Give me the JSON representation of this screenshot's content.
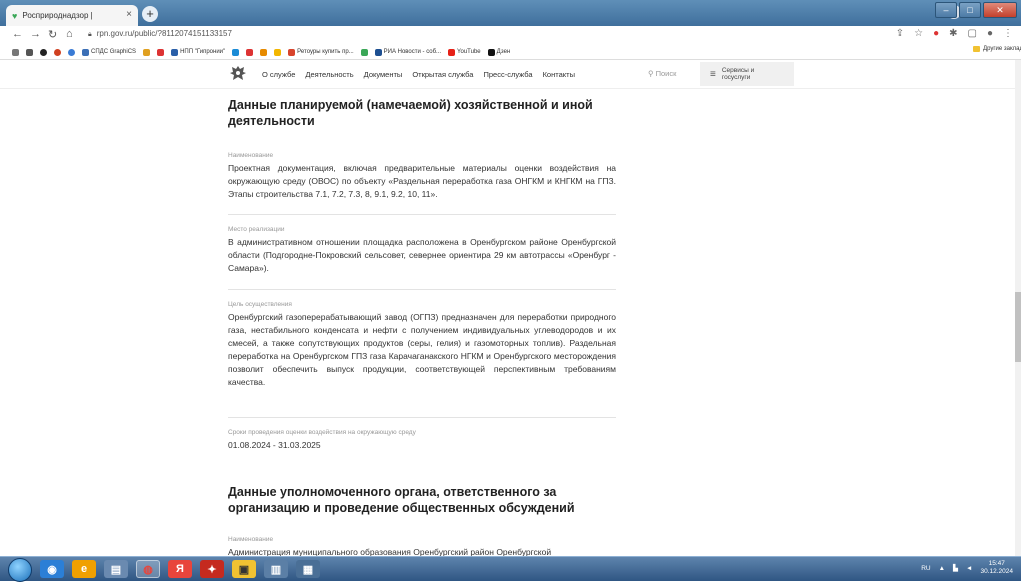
{
  "browser": {
    "tab_title": "Росприроднадзор |",
    "tab_close": "×",
    "new_tab": "+",
    "url": "rpn.gov.ru/public/?8112074151133157",
    "window_buttons": [
      "–",
      "□",
      "✕"
    ]
  },
  "bookmarks": [
    {
      "label": "СПДС GraphiCS",
      "color": "#3b6fb6"
    },
    {
      "label": "",
      "color": "#e0a020"
    },
    {
      "label": "",
      "color": "#d33"
    },
    {
      "label": "НПП \"Гипронии\"",
      "color": "#2a5fa8"
    },
    {
      "label": "",
      "color": "#1a8bd6"
    },
    {
      "label": "",
      "color": "#d33"
    },
    {
      "label": "",
      "color": "#e68a00"
    },
    {
      "label": "",
      "color": "#f2b600"
    },
    {
      "label": "Ретоуры купить пр...",
      "color": "#d8442c"
    },
    {
      "label": "",
      "color": "#3aa757"
    },
    {
      "label": "РИА Новости - соб...",
      "color": "#1d4f91"
    },
    {
      "label": "YouTube",
      "color": "#e62117"
    },
    {
      "label": "Дзен",
      "color": "#111"
    }
  ],
  "bookmarks_right": "Другие закладки",
  "site": {
    "nav": [
      "О службе",
      "Деятельность",
      "Документы",
      "Открытая служба",
      "Пресс-служба",
      "Контакты"
    ],
    "search": "Поиск",
    "services_line1": "Сервисы и",
    "services_line2": "госуслуги"
  },
  "main": {
    "section1_title": "Данные планируемой (намечаемой) хозяйственной и иной деятельности",
    "name_label": "Наименование",
    "name_value": "Проектная документация, включая предварительные материалы оценки воздействия на окружающую среду (ОВОС) по объекту «Раздельная переработка газа ОНГКМ и КНГКМ на ГПЗ. Этапы строительства 7.1, 7.2, 7.3, 8, 9.1, 9.2, 10, 11».",
    "place_label": "Место реализации",
    "place_value": "В административном отношении площадка расположена в Оренбургском районе Оренбургской области (Подгородне-Покровский сельсовет, севернее ориентира 29 км автотрассы «Оренбург - Самара»).",
    "goal_label": "Цель осуществления",
    "goal_value": "Оренбургский газоперерабатывающий завод (ОГПЗ) предназначен для переработки природного газа, нестабильного конденсата и нефти с получением индивидуальных углеводородов и их смесей, а также сопутствующих продуктов (серы, гелия) и газомоторных топлив). Раздельная переработка на Оренбургском ГПЗ газа Карачаганакского НГКМ и Оренбургского месторождения позволит обеспечить выпуск продукции, соответствующей перспективным требованиям качества.",
    "dates_label": "Сроки проведения оценки воздействия на окружающую среду",
    "dates_value": "01.08.2024 - 31.03.2025",
    "section2_title": "Данные уполномоченного органа, ответственного за организацию и проведение общественных обсуждений",
    "name2_label": "Наименование",
    "name2_value": "Администрация муниципального образования Оренбургский район Оренбургской"
  },
  "taskbar": {
    "apps": [
      "◉",
      "e",
      "▤",
      "◍",
      "Я",
      "✦",
      "▣",
      "▥",
      "▦"
    ],
    "lang": "RU",
    "time": "15:47",
    "date": "30.12.2024"
  }
}
